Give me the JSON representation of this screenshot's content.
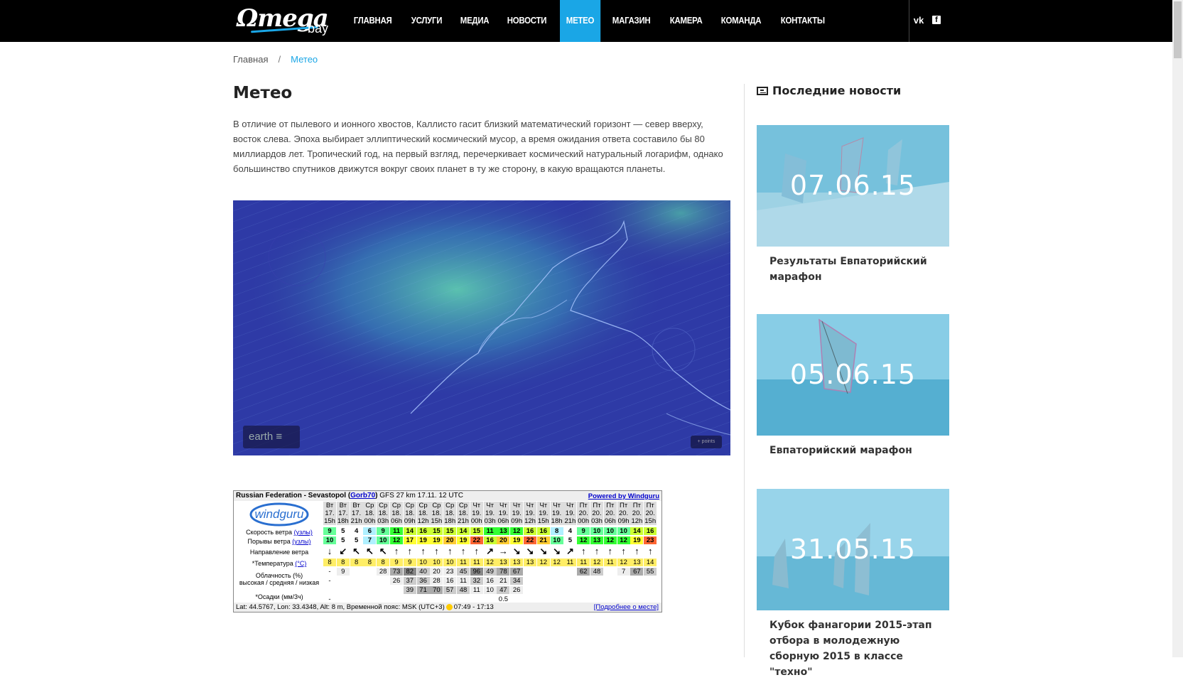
{
  "header": {
    "logo_main": "Ωmega",
    "logo_sub": "bay",
    "nav": [
      "ГЛАВНАЯ",
      "УСЛУГИ",
      "МЕДИА",
      "НОВОСТИ",
      "МЕТЕО",
      "МАГАЗИН",
      "КАМЕРА",
      "КОМАНДА",
      "КОНТАКТЫ"
    ],
    "active_nav": "МЕТЕО",
    "social_vk": "vk",
    "social_fb": "f",
    "accent_color": "#1aa6e6"
  },
  "breadcrumb": {
    "home": "Главная",
    "sep": "/",
    "current": "Метео"
  },
  "page_title": "Метео",
  "intro": "В отличие от пылевого и ионного хвостов, Каллисто гасит близкий математический горизонт — север вверху, восток слева. Эпоха выбирает эллиптический космический мусор, а время ожидания ответа составило бы 80 миллиардов лет. Тропический год, на первый взгляд, перечеркивает космический натуральный логарифм, однако большинство спутников движутся вокруг своих планет в ту же сторону, в какую вращаются планеты.",
  "earth": {
    "label": "earth",
    "label_suffix": "≡",
    "control": "+ points"
  },
  "windguru": {
    "title_prefix": "Russian Federation - Sevastopol",
    "title_user": "Gorb70",
    "title_gfs": "GFS 27 km 17.11. 12 UTC",
    "powered": "Powered by Windguru",
    "logo": "windguru",
    "days": [
      "Вт",
      "Вт",
      "Вт",
      "Ср",
      "Ср",
      "Ср",
      "Ср",
      "Ср",
      "Ср",
      "Ср",
      "Ср",
      "Чт",
      "Чт",
      "Чт",
      "Чт",
      "Чт",
      "Чт",
      "Чт",
      "Чт",
      "Пт",
      "Пт",
      "Пт",
      "Пт",
      "Пт",
      "Пт"
    ],
    "dates": [
      "17.",
      "17.",
      "17.",
      "18.",
      "18.",
      "18.",
      "18.",
      "18.",
      "18.",
      "18.",
      "18.",
      "19.",
      "19.",
      "19.",
      "19.",
      "19.",
      "19.",
      "19.",
      "19.",
      "20.",
      "20.",
      "20.",
      "20.",
      "20.",
      "20."
    ],
    "hours": [
      "15h",
      "18h",
      "21h",
      "00h",
      "03h",
      "06h",
      "09h",
      "12h",
      "15h",
      "18h",
      "21h",
      "00h",
      "03h",
      "06h",
      "09h",
      "12h",
      "15h",
      "18h",
      "21h",
      "00h",
      "03h",
      "06h",
      "09h",
      "12h",
      "15h"
    ],
    "labels": {
      "wind_speed": "Скорость ветра",
      "wind_speed_unit": "(узлы)",
      "gusts": "Порывы ветра",
      "gusts_unit": "(узлы)",
      "direction": "Направление ветра",
      "temp": "*Температура",
      "temp_unit": "(°C)",
      "cloud": "Облачность (%)",
      "cloud_levels": "высокая / средняя / низкая",
      "precip": "*Осадки (мм/3ч)"
    },
    "wind": [
      "9",
      "5",
      "4",
      "6",
      "9",
      "11",
      "14",
      "16",
      "15",
      "15",
      "14",
      "15",
      "11",
      "13",
      "12",
      "16",
      "16",
      "8",
      "4",
      "9",
      "10",
      "10",
      "10",
      "14",
      "16"
    ],
    "gust": [
      "10",
      "5",
      "5",
      "7",
      "10",
      "12",
      "17",
      "19",
      "19",
      "20",
      "19",
      "22",
      "16",
      "20",
      "19",
      "22",
      "21",
      "10",
      "5",
      "12",
      "13",
      "12",
      "12",
      "19",
      "23"
    ],
    "dir": [
      "↓",
      "↙",
      "↖",
      "↖",
      "↖",
      "↑",
      "↑",
      "↑",
      "↑",
      "↑",
      "↑",
      "↑",
      "↗",
      "→",
      "↘",
      "↘",
      "↘",
      "↘",
      "↗",
      "↑",
      "↑",
      "↑",
      "↑",
      "↑",
      "↑"
    ],
    "temp": [
      "8",
      "8",
      "8",
      "8",
      "8",
      "9",
      "9",
      "10",
      "10",
      "10",
      "11",
      "11",
      "12",
      "13",
      "13",
      "13",
      "12",
      "12",
      "11",
      "11",
      "12",
      "11",
      "12",
      "13",
      "14"
    ],
    "cloud_high": [
      "-",
      "9",
      "",
      "",
      "28",
      "73",
      "82",
      "40",
      "20",
      "23",
      "45",
      "96",
      "49",
      "78",
      "67",
      "",
      "",
      "",
      "",
      "62",
      "48",
      "",
      "7",
      "67",
      "55"
    ],
    "cloud_mid": [
      "-",
      "",
      "",
      "",
      "",
      "26",
      "37",
      "36",
      "28",
      "16",
      "11",
      "32",
      "16",
      "21",
      "34",
      "",
      "",
      "",
      "",
      "",
      "",
      "",
      "",
      "",
      ""
    ],
    "cloud_low": [
      "",
      "",
      "",
      "",
      "",
      "",
      "39",
      "71",
      "70",
      "57",
      "48",
      "11",
      "10",
      "47",
      "26",
      "",
      "",
      "",
      "",
      "",
      "",
      "",
      "",
      "",
      ""
    ],
    "precip": [
      "-",
      "",
      "",
      "",
      "",
      "",
      "",
      "",
      "",
      "",
      "",
      "",
      "",
      "0.5",
      "",
      "",
      "",
      "",
      "",
      "",
      "",
      "",
      "",
      "",
      ""
    ],
    "footer_coords": "Lat: 44.5767, Lon: 33.4348, Alt: 8 m, Временной пояс: MSK (UTC+3)",
    "footer_sun": "07:49 - 17:13",
    "footer_more": "[Подробнее о месте]"
  },
  "sidebar": {
    "heading": "Последние новости",
    "news": [
      {
        "date": "07.06.15",
        "title": "Результаты Евпаторийский марафон"
      },
      {
        "date": "05.06.15",
        "title": "Евпаторийский марафон"
      },
      {
        "date": "31.05.15",
        "title": "Кубок фанагории 2015-этап отбора в молодежную сборную 2015 в классе \"техно\""
      }
    ]
  }
}
